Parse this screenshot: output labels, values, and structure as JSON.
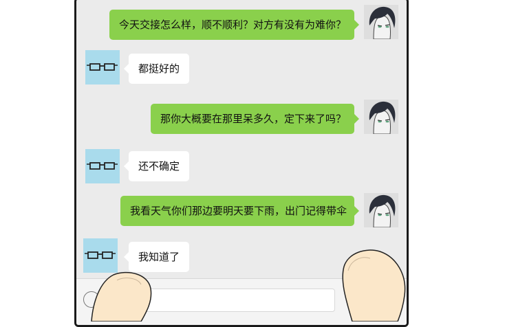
{
  "chat": {
    "messages": [
      {
        "side": "out",
        "text": "今天交接怎么样，顺不顺利？对方有没有为难你？"
      },
      {
        "side": "in",
        "text": "都挺好的"
      },
      {
        "side": "out",
        "text": "那你大概要在那里呆多久，定下来了吗？"
      },
      {
        "side": "in",
        "text": "还不确定"
      },
      {
        "side": "out",
        "text": "我看天气你们那边要明天要下雨，出门记得带伞"
      },
      {
        "side": "in",
        "text": "我知道了"
      }
    ]
  },
  "avatars": {
    "self": "man-portrait-icon",
    "contact": "glasses-icon"
  },
  "colors": {
    "outgoing_bubble": "#8ad04c",
    "incoming_bubble": "#ffffff",
    "chat_background": "#ebebeb",
    "contact_avatar_bg": "#a9dbec"
  }
}
